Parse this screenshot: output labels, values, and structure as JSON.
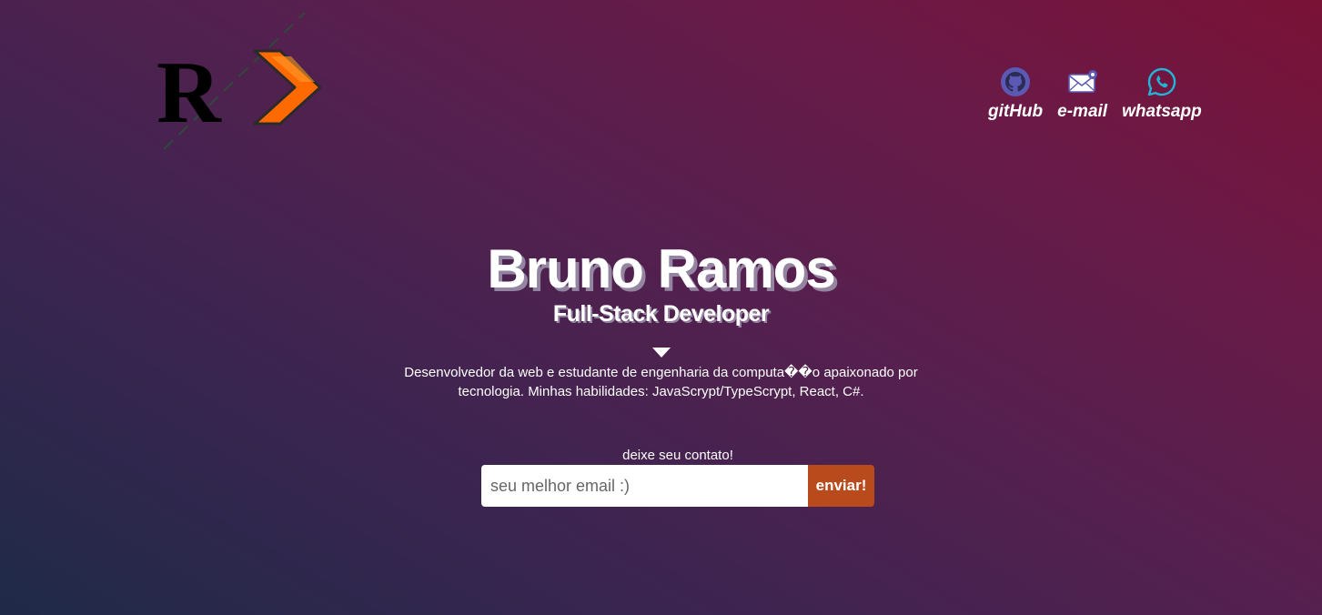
{
  "header": {
    "logo": {
      "letter": "R",
      "name": "logo"
    },
    "social": [
      {
        "label": "gitHub",
        "icon": "github-icon"
      },
      {
        "label": "e-mail",
        "icon": "mail-icon"
      },
      {
        "label": "whatsapp",
        "icon": "whatsapp-icon"
      }
    ]
  },
  "hero": {
    "name": "Bruno Ramos",
    "role": "Full-Stack Developer",
    "bio": "Desenvolvedor da web e estudante de engenharia da computa��o apaixonado por tecnologia. Minhas habilidades: JavaScrypt/TypeScrypt, React, C#."
  },
  "contact": {
    "label": "deixe seu contato!",
    "placeholder": "seu melhor email :)",
    "button": "enviar!"
  },
  "colors": {
    "accent": "#b84a1c",
    "logo_orange": "#ff6a00",
    "icon_purple": "#5b59b3",
    "icon_cyan": "#1fb6d8"
  }
}
